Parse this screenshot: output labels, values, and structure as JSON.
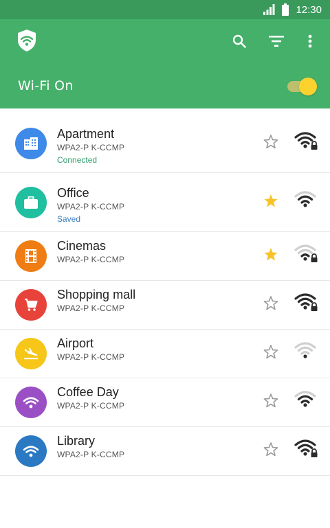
{
  "status_bar": {
    "time": "12:30"
  },
  "toolbar": {
    "logo_icon": "shield-wifi-icon",
    "search_icon": "search-icon",
    "filter_icon": "filter-icon",
    "more_icon": "more-vert-icon"
  },
  "wifi_header": {
    "title": "Wi-Fi On",
    "toggle_on": true
  },
  "colors": {
    "primary": "#45b06a",
    "primary_dark": "#3a9a5b",
    "accent": "#fbd22e",
    "connected": "#2e9d6a",
    "saved": "#3b7fbf"
  },
  "networks": [
    {
      "name": "Apartment",
      "security": "WPA2-P K-CCMP",
      "status": "Connected",
      "status_color": "#2e9d6a",
      "icon": "building-icon",
      "avatar_color": "#3f8ae8",
      "starred": false,
      "signal_level": 4,
      "locked": true
    },
    {
      "name": "Office",
      "security": "WPA2-P K-CCMP",
      "status": "Saved",
      "status_color": "#3b7fbf",
      "icon": "briefcase-icon",
      "avatar_color": "#1fbfa0",
      "starred": true,
      "signal_level": 3,
      "locked": false
    },
    {
      "name": "Cinemas",
      "security": "WPA2-P K-CCMP",
      "status": "",
      "status_color": "",
      "icon": "film-icon",
      "avatar_color": "#ef7d14",
      "starred": true,
      "signal_level": 2,
      "locked": true
    },
    {
      "name": "Shopping mall",
      "security": "WPA2-P K-CCMP",
      "status": "",
      "status_color": "",
      "icon": "cart-icon",
      "avatar_color": "#e8433a",
      "starred": false,
      "signal_level": 4,
      "locked": true
    },
    {
      "name": "Airport",
      "security": "WPA2-P K-CCMP",
      "status": "",
      "status_color": "",
      "icon": "plane-icon",
      "avatar_color": "#f6c619",
      "starred": false,
      "signal_level": 1,
      "locked": false
    },
    {
      "name": "Coffee Day",
      "security": "WPA2-P K-CCMP",
      "status": "",
      "status_color": "",
      "icon": "wifi-icon",
      "avatar_color": "#9b4fc4",
      "starred": false,
      "signal_level": 3,
      "locked": false
    },
    {
      "name": "Library",
      "security": "WPA2-P K-CCMP",
      "status": "",
      "status_color": "",
      "icon": "wifi-icon",
      "avatar_color": "#2a79c2",
      "starred": false,
      "signal_level": 4,
      "locked": true
    }
  ]
}
